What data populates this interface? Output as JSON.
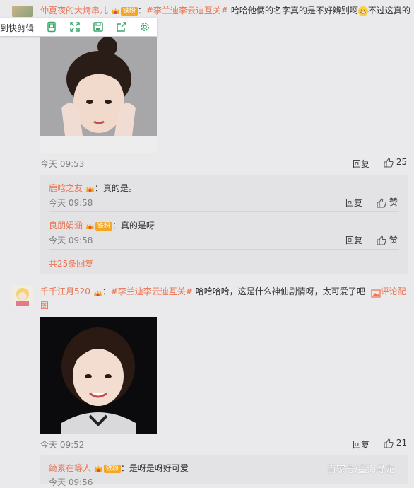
{
  "toolbar": {
    "label": "到快剪辑"
  },
  "comment1": {
    "user": "仲夏夜的大烤串儿",
    "badge": "铁粉",
    "colon": "：",
    "topic": "#李兰迪李云迪互关#",
    "text_before_emoji": " 哈哈他俩的名字真的是不好辨别啊",
    "text_after_emoji": "不过这真的",
    "time": "今天 09:53",
    "reply_label": "回复",
    "like_count": "25"
  },
  "replies1": [
    {
      "user": "鹿晗之友",
      "badge": "",
      "text": "：真的是。",
      "time": "今天 09:58",
      "reply_label": "回复",
      "like_label": "赞"
    },
    {
      "user": "良朋娟涵",
      "badge": "铁粉",
      "text": "：真的是呀",
      "time": "今天 09:58",
      "reply_label": "回复",
      "like_label": "赞"
    }
  ],
  "more_replies": "共25条回复",
  "comment2": {
    "user": "千千江月520",
    "colon": "：",
    "topic": "#李兰迪李云迪互关#",
    "text": " 哈哈哈哈，这是什么神仙剧情呀，太可爱了吧",
    "view_image_1": "评论配",
    "view_image_2": "图",
    "time": "今天 09:52",
    "reply_label": "回复",
    "like_count": "21"
  },
  "replies2": [
    {
      "user": "绮素在等人",
      "badge": "铁粉",
      "text": "：是呀是呀好可爱",
      "time": "今天 09:56"
    }
  ],
  "watermark": "百家号/墨海寻龙",
  "colors": {
    "accent": "#eb7350",
    "badge": "#f5a623",
    "background": "#eaeaec"
  }
}
